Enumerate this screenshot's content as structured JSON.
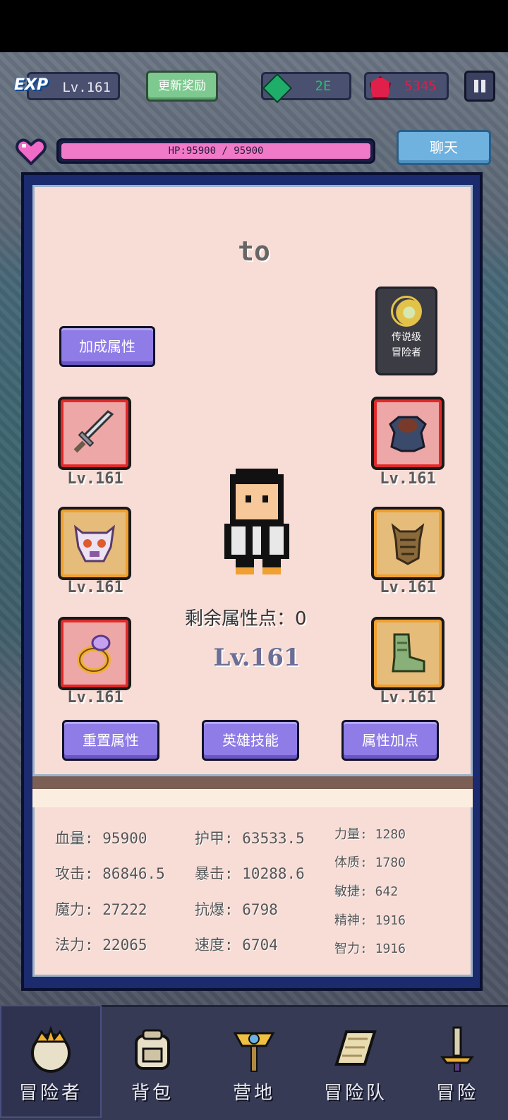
{
  "header": {
    "exp_label": "EXP",
    "level": "Lv.161",
    "update_reward": "更新奖励",
    "green_gem_amount": "2E",
    "red_gem_amount": "5345",
    "hp_text": "HP:95900 / 95900",
    "hp_fraction": 1.0,
    "chat": "聊天"
  },
  "hero": {
    "name": "to",
    "bonus_attr_button": "加成属性",
    "legend_label_1": "传说级",
    "legend_label_2": "冒险者",
    "remaining_points": "剩余属性点：0",
    "center_level": "Lv.161"
  },
  "equipment": {
    "weapon_lv": "Lv.161",
    "armor_lv": "Lv.161",
    "helmet_lv": "Lv.161",
    "chest_lv": "Lv.161",
    "ring_lv": "Lv.161",
    "boots_lv": "Lv.161"
  },
  "actions": {
    "reset": "重置属性",
    "skills": "英雄技能",
    "add_points": "属性加点"
  },
  "stats": {
    "hp": "血量: 95900",
    "attack": "攻击: 86846.5",
    "magic": "魔力: 27222",
    "spell": "法力: 22065",
    "armor": "护甲: 63533.5",
    "crit": "暴击: 10288.6",
    "anti_crit": "抗爆: 6798",
    "speed": "速度: 6704",
    "strength": "力量: 1280",
    "constitution": "体质: 1780",
    "agility": "敏捷: 642",
    "spirit": "精神: 1916",
    "intelligence": "智力: 1916"
  },
  "nav": {
    "adventurer": "冒险者",
    "backpack": "背包",
    "camp": "营地",
    "team": "冒险队",
    "adventure": "冒险"
  }
}
